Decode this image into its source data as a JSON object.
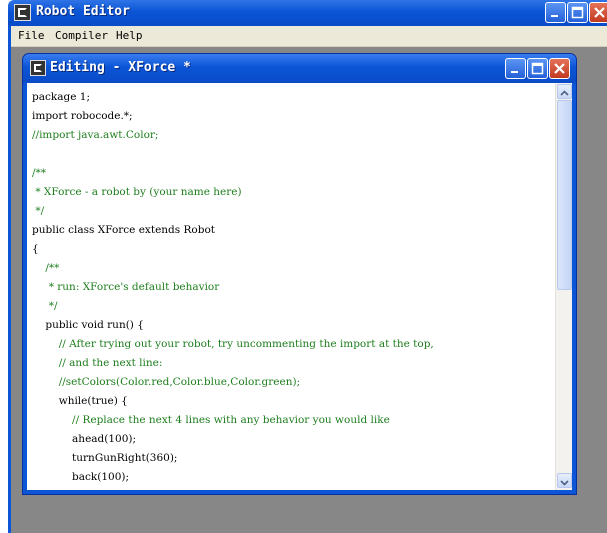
{
  "app": {
    "title": "Robot Editor",
    "menu": [
      "File",
      "Compiler",
      "Help"
    ]
  },
  "editor_window": {
    "title": "Editing - XForce *"
  },
  "code_lines": [
    {
      "text": "package 1;",
      "type": "code"
    },
    {
      "text": "import robocode.*;",
      "type": "code"
    },
    {
      "text": "//import java.awt.Color;",
      "type": "comment"
    },
    {
      "text": "",
      "type": "code"
    },
    {
      "text": "/**",
      "type": "comment"
    },
    {
      "text": " * XForce - a robot by (your name here)",
      "type": "comment"
    },
    {
      "text": " */",
      "type": "comment"
    },
    {
      "text": "public class XForce extends Robot",
      "type": "code"
    },
    {
      "text": "{",
      "type": "code"
    },
    {
      "text": "    /**",
      "type": "comment"
    },
    {
      "text": "     * run: XForce's default behavior",
      "type": "comment"
    },
    {
      "text": "     */",
      "type": "comment"
    },
    {
      "text": "    public void run() {",
      "type": "code"
    },
    {
      "text": "        // After trying out your robot, try uncommenting the import at the top,",
      "type": "comment"
    },
    {
      "text": "        // and the next line:",
      "type": "comment"
    },
    {
      "text": "        //setColors(Color.red,Color.blue,Color.green);",
      "type": "comment"
    },
    {
      "text": "        while(true) {",
      "type": "code"
    },
    {
      "text": "            // Replace the next 4 lines with any behavior you would like",
      "type": "comment"
    },
    {
      "text": "            ahead(100);",
      "type": "code"
    },
    {
      "text": "            turnGunRight(360);",
      "type": "code"
    },
    {
      "text": "            back(100);",
      "type": "code"
    }
  ],
  "colors": {
    "titlebar": "#0b55d6",
    "comment": "#1e7e1e",
    "desktop": "#878787"
  },
  "icons": [
    "app-icon",
    "minimize-icon",
    "maximize-icon",
    "close-icon",
    "scroll-up-icon",
    "scroll-down-icon"
  ]
}
